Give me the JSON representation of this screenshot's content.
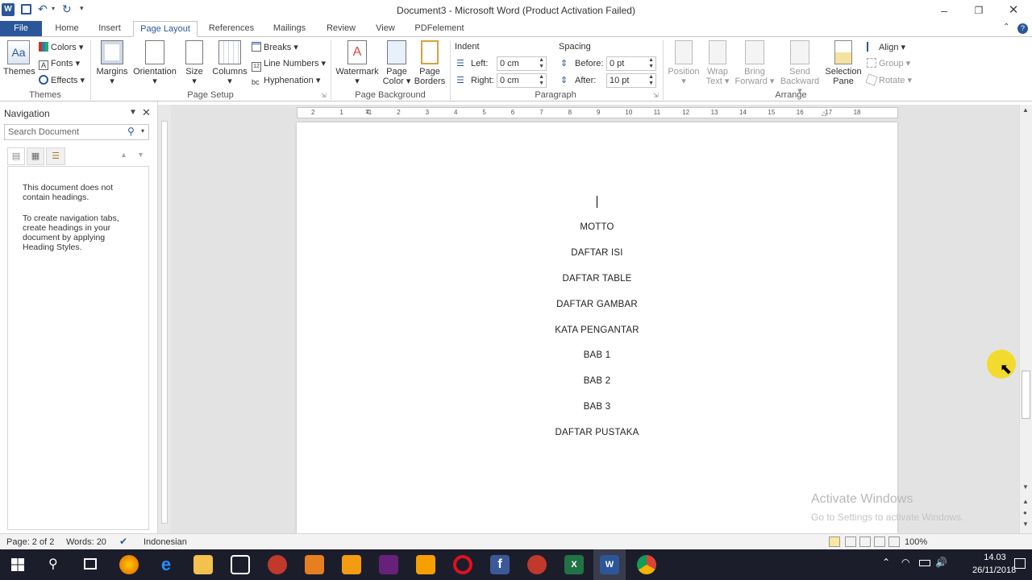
{
  "window": {
    "title": "Document3  -  Microsoft Word (Product Activation Failed)",
    "app_icon": "word-icon"
  },
  "quick_access": {
    "icons": [
      "word-icon",
      "save-icon",
      "undo-icon",
      "redo-icon",
      "customize-icon"
    ]
  },
  "tabs": [
    "File",
    "Home",
    "Insert",
    "Page Layout",
    "References",
    "Mailings",
    "Review",
    "View",
    "PDFelement"
  ],
  "active_tab": "Page Layout",
  "ribbon": {
    "themes": {
      "themes_label": "Themes",
      "colors": "Colors",
      "fonts": "Fonts",
      "effects": "Effects",
      "group": "Themes"
    },
    "page_setup": {
      "margins": "Margins",
      "orientation": "Orientation",
      "size": "Size",
      "columns": "Columns",
      "breaks": "Breaks",
      "line_numbers": "Line Numbers",
      "hyphenation": "Hyphenation",
      "group": "Page Setup"
    },
    "page_background": {
      "watermark": "Watermark",
      "page_color_1": "Page",
      "page_color_2": "Color",
      "page_borders_1": "Page",
      "page_borders_2": "Borders",
      "group": "Page Background"
    },
    "paragraph": {
      "indent_title": "Indent",
      "left_label": "Left:",
      "left_value": "0 cm",
      "right_label": "Right:",
      "right_value": "0 cm",
      "spacing_title": "Spacing",
      "before_label": "Before:",
      "before_value": "0 pt",
      "after_label": "After:",
      "after_value": "10 pt",
      "group": "Paragraph"
    },
    "arrange": {
      "position": "Position",
      "wrap_1": "Wrap",
      "wrap_2": "Text",
      "bring_1": "Bring",
      "bring_2": "Forward",
      "send_1": "Send",
      "send_2": "Backward",
      "selection_1": "Selection",
      "selection_2": "Pane",
      "align": "Align",
      "group_btn": "Group",
      "rotate": "Rotate",
      "group": "Arrange"
    }
  },
  "navigation": {
    "title": "Navigation",
    "search_placeholder": "Search Document",
    "msg1": "This document does not contain headings.",
    "msg2": "To create navigation tabs, create headings in your document by applying Heading Styles."
  },
  "ruler": {
    "marks": [
      "2",
      "1",
      "1",
      "2",
      "3",
      "4",
      "5",
      "6",
      "7",
      "8",
      "9",
      "10",
      "11",
      "12",
      "13",
      "14",
      "15",
      "16",
      "17",
      "18"
    ]
  },
  "document": {
    "lines": [
      "MOTTO",
      "DAFTAR ISI",
      "DAFTAR TABLE",
      "DAFTAR GAMBAR",
      "KATA PENGANTAR",
      "BAB 1",
      "BAB 2",
      "BAB 3",
      "DAFTAR PUSTAKA"
    ]
  },
  "watermark_overlay": {
    "activate": "Activate Windows",
    "goto": "Go to Settings to activate Windows."
  },
  "status": {
    "page": "Page: 2 of 2",
    "words": "Words: 20",
    "language": "Indonesian",
    "zoom": "100%"
  },
  "taskbar": {
    "time": "14.03",
    "date": "26/11/2018"
  },
  "colors": {
    "word_blue": "#2b579a",
    "taskbar": "#1c1d2b",
    "cursor_highlight": "#f5d800"
  }
}
